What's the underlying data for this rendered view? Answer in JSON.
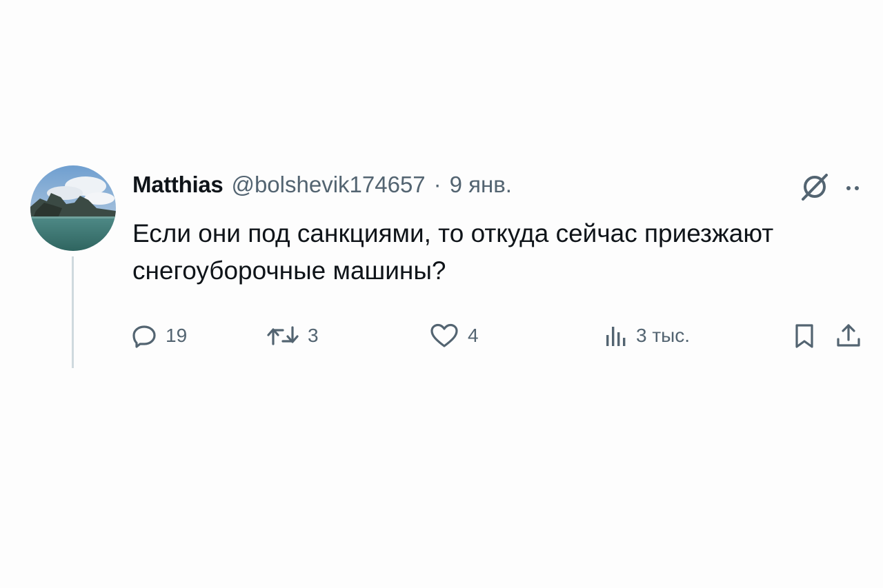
{
  "tweet": {
    "display_name": "Matthias",
    "handle": "@bolshevik174657",
    "separator": "·",
    "date": "9 янв.",
    "text": "Если они под санкциями, то откуда сейчас приезжают снегоуборочные машины?",
    "avatar_icon": "avatar-landscape-photo",
    "header_icons": [
      "grok-icon",
      "more-icon"
    ]
  },
  "actions": {
    "replies": {
      "icon": "reply-icon",
      "count": "19"
    },
    "reposts": {
      "icon": "retweet-icon",
      "count": "3"
    },
    "likes": {
      "icon": "heart-icon",
      "count": "4"
    },
    "views": {
      "icon": "views-icon",
      "count": "3 тыс."
    },
    "bookmark": {
      "icon": "bookmark-icon"
    },
    "share": {
      "icon": "share-icon"
    }
  },
  "colors": {
    "background": "#fdfdfd",
    "text_primary": "#0f1419",
    "text_secondary": "#536471",
    "thread_line": "#cfd9de"
  }
}
